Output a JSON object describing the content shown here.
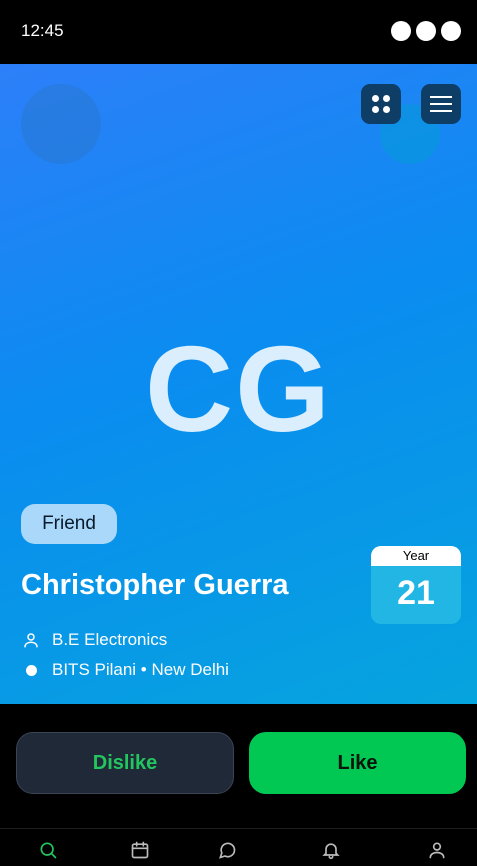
{
  "status_bar": {
    "time": "12:45"
  },
  "profile": {
    "initials": "CG",
    "tag": "Friend",
    "name": "Christopher Guerra",
    "year_label": "Year",
    "year_value": "21",
    "course": "B.E Electronics",
    "college": "BITS Pilani • New Delhi"
  },
  "actions": {
    "dislike": "Dislike",
    "like": "Like"
  },
  "nav": {
    "items": [
      {
        "icon": "search-icon",
        "active": true
      },
      {
        "icon": "calendar-icon",
        "active": false
      },
      {
        "icon": "chat-icon",
        "active": false
      },
      {
        "icon": "bell-icon",
        "active": false
      },
      {
        "icon": "user-icon",
        "active": false
      }
    ]
  },
  "colors": {
    "accent": "#00c853",
    "hero_start": "#2d7ff9",
    "hero_end": "#06a4de",
    "nav_active": "#22c55e"
  }
}
